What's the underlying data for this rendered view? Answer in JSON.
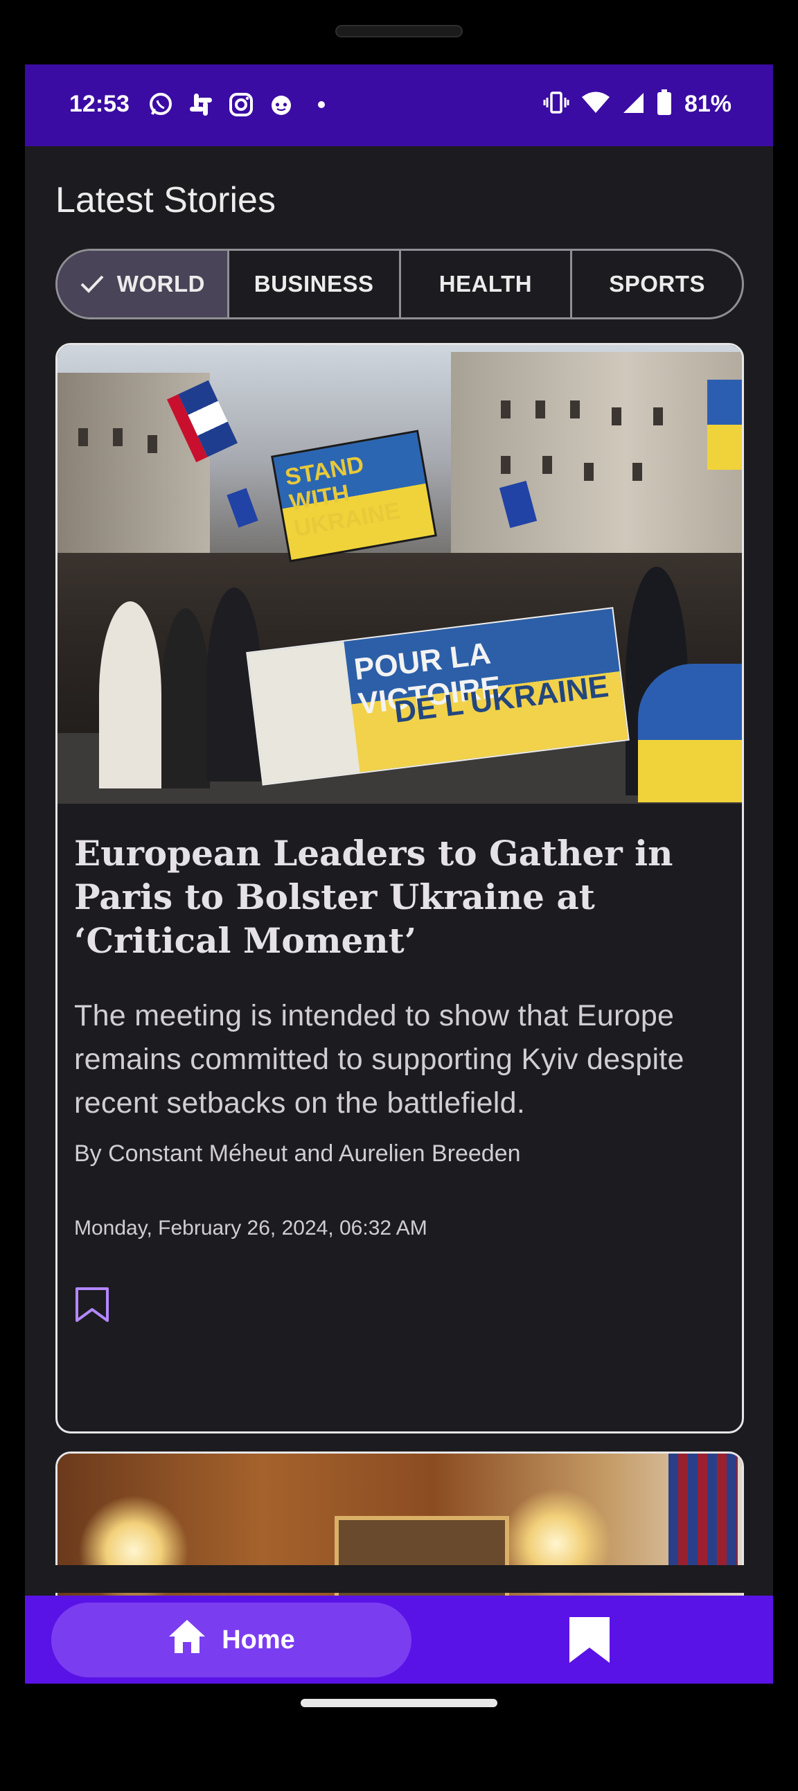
{
  "status_bar": {
    "time": "12:53",
    "left_icons": [
      "whatsapp-icon",
      "slack-icon",
      "instagram-icon",
      "reddit-icon",
      "notification-dot-icon"
    ],
    "right_icons": [
      "vibrate-icon",
      "wifi-icon",
      "signal-icon",
      "battery-icon"
    ],
    "battery": "81%"
  },
  "header": {
    "title": "Latest Stories"
  },
  "tabs": [
    {
      "label": "WORLD",
      "selected": true
    },
    {
      "label": "BUSINESS",
      "selected": false
    },
    {
      "label": "HEALTH",
      "selected": false
    },
    {
      "label": "SPORTS",
      "selected": false
    }
  ],
  "articles": [
    {
      "title": "European Leaders to Gather in Paris to Bolster Ukraine at ‘Critical Moment’",
      "description": "The meeting is intended to show that Europe remains committed to supporting Kyiv despite recent setbacks on the battlefield.",
      "byline": "By Constant Méheut and Aurelien Breeden",
      "date": "Monday, February 26, 2024, 06:32 AM",
      "image_text": {
        "sign": "STAND WITH UKRAINE",
        "banner_line1": "POUR LA VICTOIRE",
        "banner_line2": "DE L'UKRAINE"
      }
    }
  ],
  "bottom_nav": {
    "home_label": "Home",
    "items": [
      "home-icon",
      "bookmark-icon"
    ]
  },
  "colors": {
    "status_bar": "#3a0ca3",
    "background": "#1c1b1f",
    "bottom_nav": "#5a13e6",
    "nav_active_pill": "#7a3df0",
    "tab_selected": "#4a4458",
    "bookmark_accent": "#b388ff"
  }
}
